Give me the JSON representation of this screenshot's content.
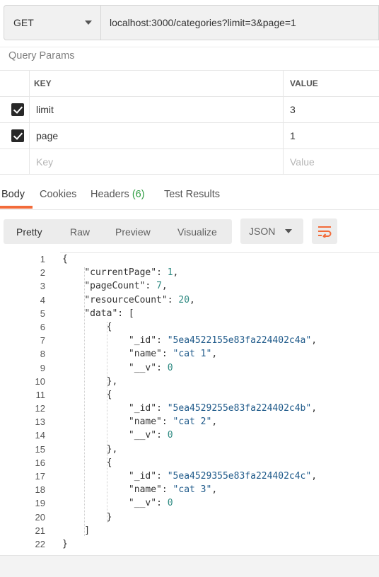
{
  "request": {
    "method": "GET",
    "url": "localhost:3000/categories?limit=3&page=1"
  },
  "query_params": {
    "title": "Query Params",
    "headers": {
      "key": "KEY",
      "value": "VALUE"
    },
    "rows": [
      {
        "key": "limit",
        "value": "3",
        "checked": true
      },
      {
        "key": "page",
        "value": "1",
        "checked": true
      }
    ],
    "placeholder": {
      "key": "Key",
      "value": "Value"
    }
  },
  "response_tabs": {
    "body": "Body",
    "cookies": "Cookies",
    "headers": "Headers",
    "headers_count": "(6)",
    "test_results": "Test Results"
  },
  "view": {
    "pretty": "Pretty",
    "raw": "Raw",
    "preview": "Preview",
    "visualize": "Visualize",
    "format": "JSON",
    "wrap_icon": "wrap-lines-icon"
  },
  "colors": {
    "accent": "#f26b3a",
    "count": "#2e9c42",
    "json_string": "#1f5a8a",
    "json_number": "#2e8a82"
  },
  "code_lines": [
    "{",
    "    \"currentPage\": 1,",
    "    \"pageCount\": 7,",
    "    \"resourceCount\": 20,",
    "    \"data\": [",
    "        {",
    "            \"_id\": \"5ea4522155e83fa224402c4a\",",
    "            \"name\": \"cat 1\",",
    "            \"__v\": 0",
    "        },",
    "        {",
    "            \"_id\": \"5ea4529255e83fa224402c4b\",",
    "            \"name\": \"cat 2\",",
    "            \"__v\": 0",
    "        },",
    "        {",
    "            \"_id\": \"5ea4529355e83fa224402c4c\",",
    "            \"name\": \"cat 3\",",
    "            \"__v\": 0",
    "        }",
    "    ]",
    "}"
  ]
}
